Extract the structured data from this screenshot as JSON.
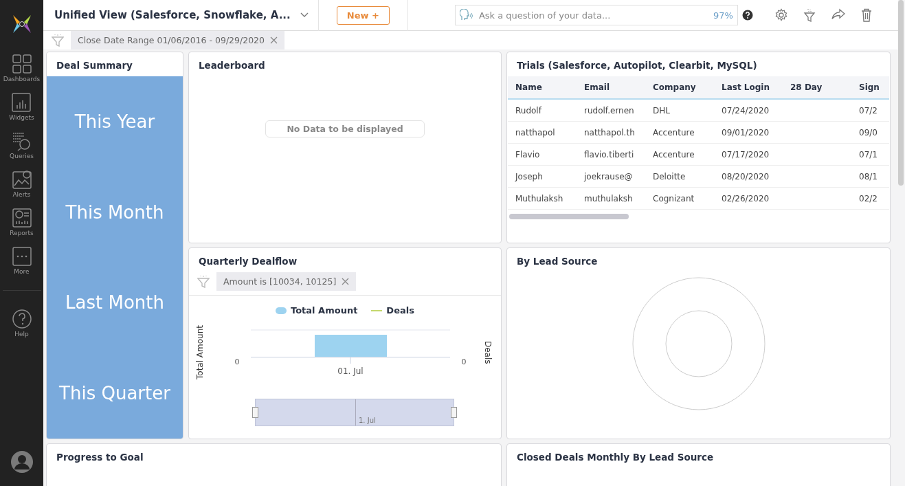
{
  "sidebar": {
    "items": [
      {
        "label": "Dashboards",
        "kind": "dashboards"
      },
      {
        "label": "Widgets",
        "kind": "widgets"
      },
      {
        "label": "Queries",
        "kind": "queries"
      },
      {
        "label": "Alerts",
        "kind": "alerts"
      },
      {
        "label": "Reports",
        "kind": "reports"
      },
      {
        "label": "More",
        "kind": "more"
      },
      {
        "label": "Help",
        "kind": "help"
      }
    ]
  },
  "header": {
    "title": "Unified View (Salesforce, Snowflake, A...",
    "new_button": "New +",
    "search": {
      "placeholder": "Ask a question of your data...",
      "confidence": "97%"
    }
  },
  "filters": [
    {
      "label": "Close Date Range 01/06/2016 - 09/29/2020"
    }
  ],
  "deal_summary": {
    "title": "Deal Summary",
    "periods": [
      "This Year",
      "This Month",
      "Last Month",
      "This Quarter"
    ]
  },
  "leaderboard": {
    "title": "Leaderboard",
    "empty_message": "No Data to be displayed"
  },
  "trials": {
    "title": "Trials (Salesforce, Autopilot, Clearbit, MySQL)",
    "columns": [
      "Name",
      "Email",
      "Company",
      "Last Login",
      "28 Day",
      "Sign"
    ],
    "rows": [
      {
        "name": "Rudolf",
        "email": "rudolf.ernen",
        "company": "DHL",
        "last_login": "07/24/2020",
        "sign_up": "07/2"
      },
      {
        "name": "natthapol",
        "email": "natthapol.th",
        "company": "Accenture",
        "last_login": "09/01/2020",
        "sign_up": "09/0"
      },
      {
        "name": "Flavio",
        "email": "flavio.tiberti",
        "company": "Accenture",
        "last_login": "07/17/2020",
        "sign_up": "07/1"
      },
      {
        "name": "Joseph",
        "email": "joekrause@",
        "company": "Deloitte",
        "last_login": "08/20/2020",
        "sign_up": "08/1"
      },
      {
        "name": "Muthulaksh",
        "email": "muthulaksh",
        "company": "Cognizant",
        "last_login": "02/26/2020",
        "sign_up": "02/2"
      }
    ]
  },
  "quarterly": {
    "title": "Quarterly Dealflow",
    "filter": "Amount is [10034, 10125]",
    "legend": [
      {
        "label": "Total Amount",
        "kind": "bar",
        "color": "#9dd3f0"
      },
      {
        "label": "Deals",
        "kind": "line",
        "color": "#c5d86d"
      }
    ],
    "left_axis": "Total Amount",
    "left_tick": "0",
    "right_axis": "Deals",
    "right_tick": "0",
    "category": "01. Jul",
    "navigator_label": "1. Jul"
  },
  "lead_source": {
    "title": "By Lead Source"
  },
  "bottom": [
    {
      "title": "Progress to Goal"
    },
    {
      "title": "Closed Deals Monthly By Lead Source"
    }
  ]
}
